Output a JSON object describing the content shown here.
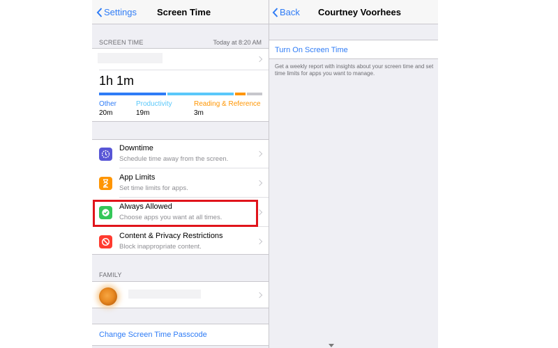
{
  "left": {
    "nav": {
      "back_label": "Settings",
      "title": "Screen Time"
    },
    "screen_time": {
      "header": "SCREEN TIME",
      "timestamp": "Today at 8:20 AM",
      "total": "1h 1m",
      "categories": [
        {
          "label": "Other",
          "value": "20m",
          "color": "#2f7cf6"
        },
        {
          "label": "Productivity",
          "value": "19m",
          "color": "#5ac8fa"
        },
        {
          "label": "Reading & Reference",
          "value": "3m",
          "color": "#ff9500"
        }
      ],
      "bar_remaining_color": "#c7c7cc"
    },
    "settings": [
      {
        "title": "Downtime",
        "subtitle": "Schedule time away from the screen.",
        "icon": "downtime-icon",
        "color": "#5856d6"
      },
      {
        "title": "App Limits",
        "subtitle": "Set time limits for apps.",
        "icon": "hourglass-icon",
        "color": "#ff9500"
      },
      {
        "title": "Always Allowed",
        "subtitle": "Choose apps you want at all times.",
        "icon": "checkmark-badge-icon",
        "color": "#34c759"
      },
      {
        "title": "Content & Privacy Restrictions",
        "subtitle": "Block inappropriate content.",
        "icon": "no-entry-icon",
        "color": "#ff3b30"
      }
    ],
    "family": {
      "header": "FAMILY"
    },
    "passcode_link": "Change Screen Time Passcode"
  },
  "right": {
    "nav": {
      "back_label": "Back",
      "title": "Courtney Voorhees"
    },
    "turn_on_label": "Turn On Screen Time",
    "description": "Get a weekly report with insights about your screen time and set time limits for apps you want to manage."
  },
  "accent_color": "#2f7cf6",
  "highlight_color": "#e0141b"
}
